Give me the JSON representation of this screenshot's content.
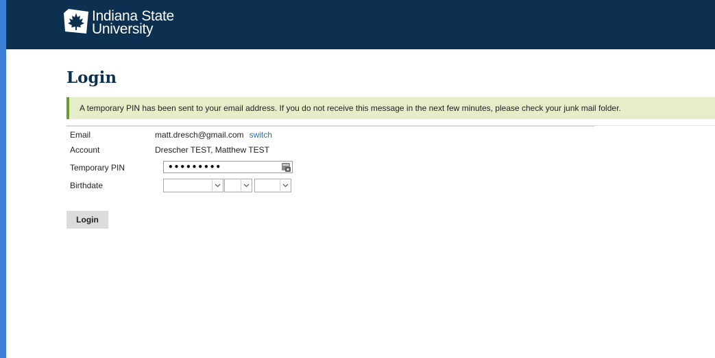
{
  "header": {
    "logo_icon": "maple-leaf-icon",
    "logo_line1": "Indiana State",
    "logo_line2": "University"
  },
  "page": {
    "title": "Login",
    "notice": "A temporary PIN has been sent to your email address. If you do not receive this message in the next few minutes, please check your junk mail folder."
  },
  "form": {
    "email_label": "Email",
    "email_value": "matt.dresch@gmail.com",
    "switch_link": "switch",
    "account_label": "Account",
    "account_value": "Drescher TEST, Matthew TEST",
    "pin_label": "Temporary PIN",
    "pin_value": "•••••••••",
    "birthdate_label": "Birthdate",
    "birth_month": "",
    "birth_day": "",
    "birth_year": "",
    "login_button": "Login"
  },
  "colors": {
    "header_bg": "#0d3050",
    "notice_bg": "#e5edc9",
    "notice_border": "#6a9c2e",
    "link": "#2a6fb0"
  }
}
